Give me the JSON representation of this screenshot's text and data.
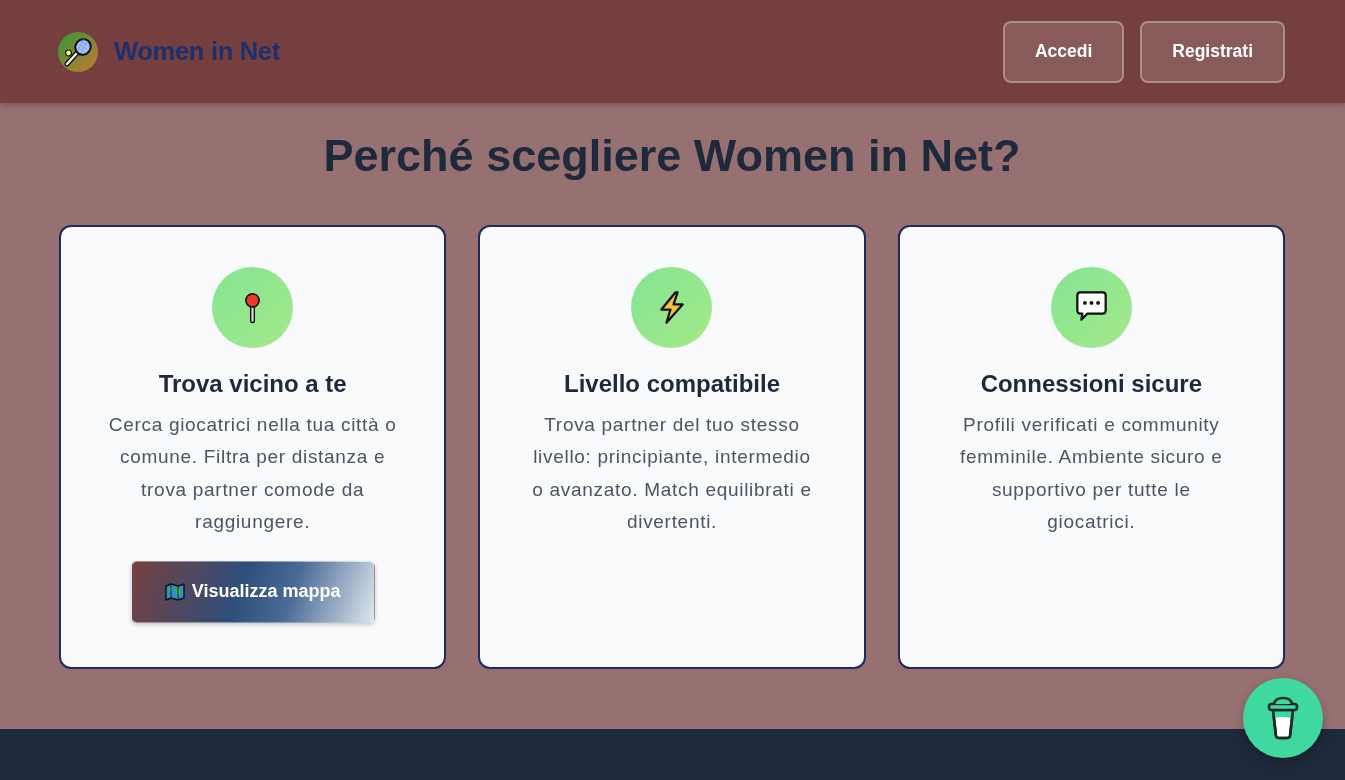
{
  "header": {
    "brand": "Women in Net",
    "buttons": [
      "Accedi",
      "Registrati"
    ]
  },
  "section": {
    "title": "Perché scegliere Women in Net?",
    "features": [
      {
        "kind": "location",
        "title": "Trova vicino a te",
        "description": "Cerca giocatrici nella tua città o comune. Filtra per distanza e trova partner comode da raggiungere.",
        "button": "Visualizza mappa"
      },
      {
        "kind": "level",
        "title": "Livello compatibile",
        "description": "Trova partner del tuo stesso livello: principiante, intermedio o avanzato. Match equilibrati e divertenti."
      },
      {
        "kind": "secure",
        "title": "Connessioni sicure",
        "description": "Profili verificati e community femminile. Ambiente sicuro e supportivo per tutte le giocatrici."
      }
    ]
  }
}
